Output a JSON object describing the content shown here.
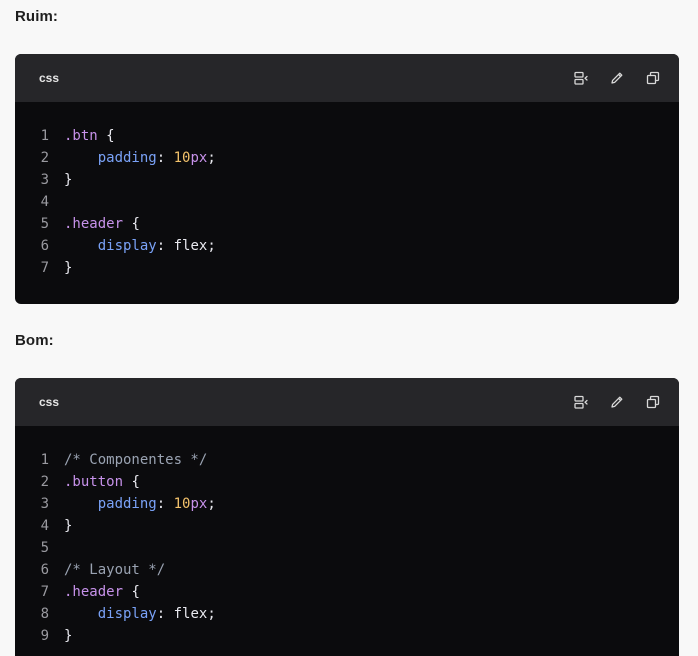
{
  "colors": {
    "page_background": "#f8f8f8",
    "code_background": "#0b0b0d",
    "code_header_background": "#262629",
    "selector": "#c792ea",
    "property": "#7aa2f7",
    "number": "#f3c26b",
    "comment": "#9aa3b2",
    "line_number": "#9a9aa0"
  },
  "icons": {
    "wrap": "wrap-lines-icon",
    "edit": "pencil-icon",
    "copy": "copy-icon"
  },
  "sections": [
    {
      "label": "Ruim:",
      "block": {
        "language": "css",
        "lines": [
          {
            "n": "1",
            "tokens": [
              {
                "t": ".btn",
                "k": "sel"
              },
              {
                "t": " {",
                "k": "punc"
              }
            ]
          },
          {
            "n": "2",
            "tokens": [
              {
                "t": "    ",
                "k": "punc"
              },
              {
                "t": "padding",
                "k": "prop"
              },
              {
                "t": ": ",
                "k": "punc"
              },
              {
                "t": "10",
                "k": "num"
              },
              {
                "t": "px",
                "k": "unit"
              },
              {
                "t": ";",
                "k": "punc"
              }
            ]
          },
          {
            "n": "3",
            "tokens": [
              {
                "t": "}",
                "k": "punc"
              }
            ]
          },
          {
            "n": "4",
            "tokens": []
          },
          {
            "n": "5",
            "tokens": [
              {
                "t": ".header",
                "k": "sel"
              },
              {
                "t": " {",
                "k": "punc"
              }
            ]
          },
          {
            "n": "6",
            "tokens": [
              {
                "t": "    ",
                "k": "punc"
              },
              {
                "t": "display",
                "k": "prop"
              },
              {
                "t": ": ",
                "k": "punc"
              },
              {
                "t": "flex",
                "k": "val"
              },
              {
                "t": ";",
                "k": "punc"
              }
            ]
          },
          {
            "n": "7",
            "tokens": [
              {
                "t": "}",
                "k": "punc"
              }
            ]
          }
        ]
      }
    },
    {
      "label": "Bom:",
      "block": {
        "language": "css",
        "lines": [
          {
            "n": "1",
            "tokens": [
              {
                "t": "/* Componentes */",
                "k": "comment"
              }
            ]
          },
          {
            "n": "2",
            "tokens": [
              {
                "t": ".button",
                "k": "sel"
              },
              {
                "t": " {",
                "k": "punc"
              }
            ]
          },
          {
            "n": "3",
            "tokens": [
              {
                "t": "    ",
                "k": "punc"
              },
              {
                "t": "padding",
                "k": "prop"
              },
              {
                "t": ": ",
                "k": "punc"
              },
              {
                "t": "10",
                "k": "num"
              },
              {
                "t": "px",
                "k": "unit"
              },
              {
                "t": ";",
                "k": "punc"
              }
            ]
          },
          {
            "n": "4",
            "tokens": [
              {
                "t": "}",
                "k": "punc"
              }
            ]
          },
          {
            "n": "5",
            "tokens": []
          },
          {
            "n": "6",
            "tokens": [
              {
                "t": "/* Layout */",
                "k": "comment"
              }
            ]
          },
          {
            "n": "7",
            "tokens": [
              {
                "t": ".header",
                "k": "sel"
              },
              {
                "t": " {",
                "k": "punc"
              }
            ]
          },
          {
            "n": "8",
            "tokens": [
              {
                "t": "    ",
                "k": "punc"
              },
              {
                "t": "display",
                "k": "prop"
              },
              {
                "t": ": ",
                "k": "punc"
              },
              {
                "t": "flex",
                "k": "val"
              },
              {
                "t": ";",
                "k": "punc"
              }
            ]
          },
          {
            "n": "9",
            "tokens": [
              {
                "t": "}",
                "k": "punc"
              }
            ]
          }
        ]
      }
    }
  ]
}
